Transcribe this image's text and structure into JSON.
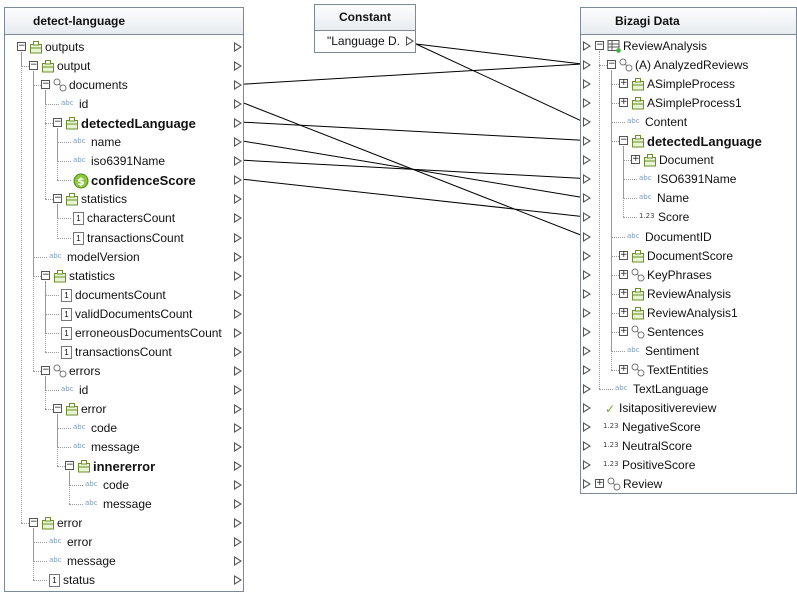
{
  "left_panel": {
    "title": "detect-language",
    "rows": [
      {
        "label": "outputs",
        "icon": "object-icon",
        "expander": "minus",
        "level": 0
      },
      {
        "label": "output",
        "icon": "object-icon",
        "expander": "minus",
        "level": 1
      },
      {
        "label": "documents",
        "icon": "collection-icon",
        "expander": "minus",
        "level": 2
      },
      {
        "label": "id",
        "icon": "text-field-icon",
        "expander": "",
        "level": 3
      },
      {
        "label": "detectedLanguage",
        "icon": "object-icon",
        "expander": "minus",
        "level": 3,
        "big": true
      },
      {
        "label": "name",
        "icon": "text-field-icon",
        "expander": "",
        "level": 4
      },
      {
        "label": "iso6391Name",
        "icon": "text-field-icon",
        "expander": "",
        "level": 4
      },
      {
        "label": "confidenceScore",
        "icon": "currency-icon",
        "expander": "",
        "level": 4,
        "big": true
      },
      {
        "label": "statistics",
        "icon": "object-icon",
        "expander": "minus",
        "level": 3
      },
      {
        "label": "charactersCount",
        "icon": "number-field-icon",
        "expander": "",
        "level": 4
      },
      {
        "label": "transactionsCount",
        "icon": "number-field-icon",
        "expander": "",
        "level": 4
      },
      {
        "label": "modelVersion",
        "icon": "text-field-icon",
        "expander": "",
        "level": 2
      },
      {
        "label": "statistics",
        "icon": "object-icon",
        "expander": "minus",
        "level": 2
      },
      {
        "label": "documentsCount",
        "icon": "number-field-icon",
        "expander": "",
        "level": 3
      },
      {
        "label": "validDocumentsCount",
        "icon": "number-field-icon",
        "expander": "",
        "level": 3
      },
      {
        "label": "erroneousDocumentsCount",
        "icon": "number-field-icon",
        "expander": "",
        "level": 3
      },
      {
        "label": "transactionsCount",
        "icon": "number-field-icon",
        "expander": "",
        "level": 3
      },
      {
        "label": "errors",
        "icon": "collection-icon",
        "expander": "minus",
        "level": 2
      },
      {
        "label": "id",
        "icon": "text-field-icon",
        "expander": "",
        "level": 3
      },
      {
        "label": "error",
        "icon": "object-icon",
        "expander": "minus",
        "level": 3
      },
      {
        "label": "code",
        "icon": "text-field-icon",
        "expander": "",
        "level": 4
      },
      {
        "label": "message",
        "icon": "text-field-icon",
        "expander": "",
        "level": 4
      },
      {
        "label": "innererror",
        "icon": "object-icon",
        "expander": "minus",
        "level": 4,
        "big": true
      },
      {
        "label": "code",
        "icon": "text-field-icon",
        "expander": "",
        "level": 5
      },
      {
        "label": "message",
        "icon": "text-field-icon",
        "expander": "",
        "level": 5
      },
      {
        "label": "error",
        "icon": "object-icon",
        "expander": "minus",
        "level": 1
      },
      {
        "label": "error",
        "icon": "text-field-icon",
        "expander": "",
        "level": 2
      },
      {
        "label": "message",
        "icon": "text-field-icon",
        "expander": "",
        "level": 2
      },
      {
        "label": "status",
        "icon": "number-field-icon",
        "expander": "",
        "level": 2
      }
    ]
  },
  "constant_panel": {
    "title": "Constant",
    "value": "\"Language D."
  },
  "right_panel": {
    "title": "Bizagi Data",
    "rows": [
      {
        "label": "ReviewAnalysis",
        "icon": "entity-table-icon",
        "expander": "minus",
        "level": 0
      },
      {
        "label": "(A) AnalyzedReviews",
        "icon": "collection-icon",
        "expander": "minus",
        "level": 1
      },
      {
        "label": "ASimpleProcess",
        "icon": "object-icon",
        "expander": "plus",
        "level": 2
      },
      {
        "label": "ASimpleProcess1",
        "icon": "object-icon",
        "expander": "plus",
        "level": 2
      },
      {
        "label": "Content",
        "icon": "text-field-icon",
        "expander": "",
        "level": 2
      },
      {
        "label": "detectedLanguage",
        "icon": "object-icon",
        "expander": "minus",
        "level": 2,
        "big": true
      },
      {
        "label": "Document",
        "icon": "object-icon",
        "expander": "plus",
        "level": 3
      },
      {
        "label": "ISO6391Name",
        "icon": "text-field-icon",
        "expander": "",
        "level": 3
      },
      {
        "label": "Name",
        "icon": "text-field-icon",
        "expander": "",
        "level": 3
      },
      {
        "label": "Score",
        "icon": "decimal-field-icon",
        "expander": "",
        "level": 3
      },
      {
        "label": "DocumentID",
        "icon": "text-field-icon",
        "expander": "",
        "level": 2
      },
      {
        "label": "DocumentScore",
        "icon": "object-icon",
        "expander": "plus",
        "level": 2
      },
      {
        "label": "KeyPhrases",
        "icon": "collection-icon",
        "expander": "plus",
        "level": 2
      },
      {
        "label": "ReviewAnalysis",
        "icon": "object-icon",
        "expander": "plus",
        "level": 2
      },
      {
        "label": "ReviewAnalysis1",
        "icon": "object-icon",
        "expander": "plus",
        "level": 2
      },
      {
        "label": "Sentences",
        "icon": "collection-icon",
        "expander": "plus",
        "level": 2
      },
      {
        "label": "Sentiment",
        "icon": "text-field-icon",
        "expander": "",
        "level": 2
      },
      {
        "label": "TextEntities",
        "icon": "collection-icon",
        "expander": "plus",
        "level": 2
      },
      {
        "label": "TextLanguage",
        "icon": "text-field-icon",
        "expander": "",
        "level": 1
      },
      {
        "label": "Isitapositivereview",
        "icon": "boolean-check-icon",
        "expander": "",
        "level": 0
      },
      {
        "label": "NegativeScore",
        "icon": "decimal-field-icon",
        "expander": "",
        "level": 0
      },
      {
        "label": "NeutralScore",
        "icon": "decimal-field-icon",
        "expander": "",
        "level": 0
      },
      {
        "label": "PositiveScore",
        "icon": "decimal-field-icon",
        "expander": "",
        "level": 0
      },
      {
        "label": "Review",
        "icon": "collection-icon",
        "expander": "plus",
        "level": 0
      }
    ]
  },
  "icon_glyphs": {
    "text_field": "abc",
    "number_field": "1",
    "decimal_field": "1.23",
    "currency": "$",
    "check": "✓"
  },
  "mappings": [
    {
      "from": "constant.value",
      "to": "right.(A) AnalyzedReviews"
    },
    {
      "from": "left.documents",
      "to": "right.(A) AnalyzedReviews"
    },
    {
      "from": "left.id",
      "to": "right.DocumentID"
    },
    {
      "from": "left.detectedLanguage",
      "to": "right.detectedLanguage"
    },
    {
      "from": "left.name",
      "to": "right.Name"
    },
    {
      "from": "left.iso6391Name",
      "to": "right.ISO6391Name"
    },
    {
      "from": "left.confidenceScore",
      "to": "right.Score"
    },
    {
      "from": "constant.value",
      "to": "right.Content"
    }
  ]
}
